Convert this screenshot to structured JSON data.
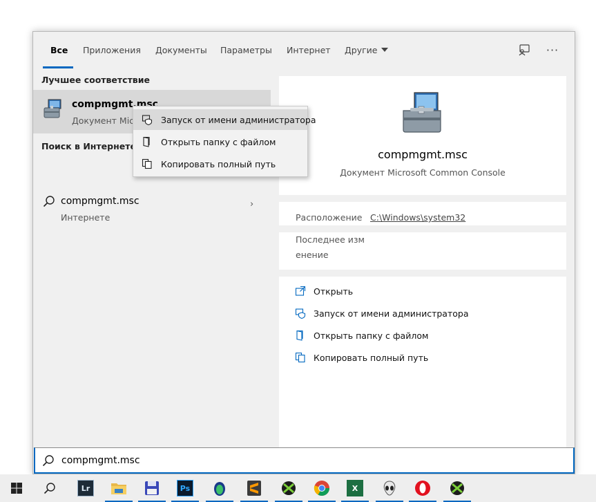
{
  "tabs": [
    {
      "label": "Все",
      "active": true
    },
    {
      "label": "Приложения"
    },
    {
      "label": "Документы"
    },
    {
      "label": "Параметры"
    },
    {
      "label": "Интернет"
    },
    {
      "label": "Другие"
    }
  ],
  "header_icons": [
    "feedback-icon",
    "more-icon"
  ],
  "header_more_glyph": "···",
  "left": {
    "best_match_title": "Лучшее соответствие",
    "best_match": {
      "name": "compmgmt.msc",
      "subtitle": "Документ Microsoft Common Console",
      "icon": "computer-management-icon"
    },
    "web_section_title": "Поиск в Интернете",
    "web_item": {
      "name": "compmgmt.msc",
      "subtitle": "Интернете",
      "arrow": "›"
    }
  },
  "context_menu": [
    {
      "label": "Запуск от имени администратора",
      "icon": "shield-icon",
      "hover": true
    },
    {
      "label": "Открыть папку с файлом",
      "icon": "folder-icon"
    },
    {
      "label": "Копировать полный путь",
      "icon": "copy-icon"
    }
  ],
  "detail": {
    "title": "compmgmt.msc",
    "subtitle": "Документ Microsoft Common Console",
    "location_label": "Расположение",
    "location_value": "C:\\Windows\\system32",
    "modified_label_line1": "Последнее изм",
    "modified_label_line2": "енение",
    "actions": [
      {
        "label": "Открыть",
        "icon": "open-icon"
      },
      {
        "label": "Запуск от имени администратора",
        "icon": "shield-icon"
      },
      {
        "label": "Открыть папку с файлом",
        "icon": "folder-icon"
      },
      {
        "label": "Копировать полный путь",
        "icon": "copy-icon"
      }
    ]
  },
  "search": {
    "value": "compmgmt.msc"
  },
  "taskbar": {
    "lr_label": "Lr",
    "ps_label": "Ps",
    "excel_label": "X",
    "items": [
      "start-icon",
      "search-icon",
      "lightroom-icon",
      "file-explorer-icon",
      "save-app-icon",
      "photoshop-icon",
      "gem-app-icon",
      "sublime-icon",
      "xbox-app-icon",
      "chrome-icon",
      "excel-icon",
      "alien-app-icon",
      "opera-icon",
      "xbox-app-icon-2"
    ]
  }
}
